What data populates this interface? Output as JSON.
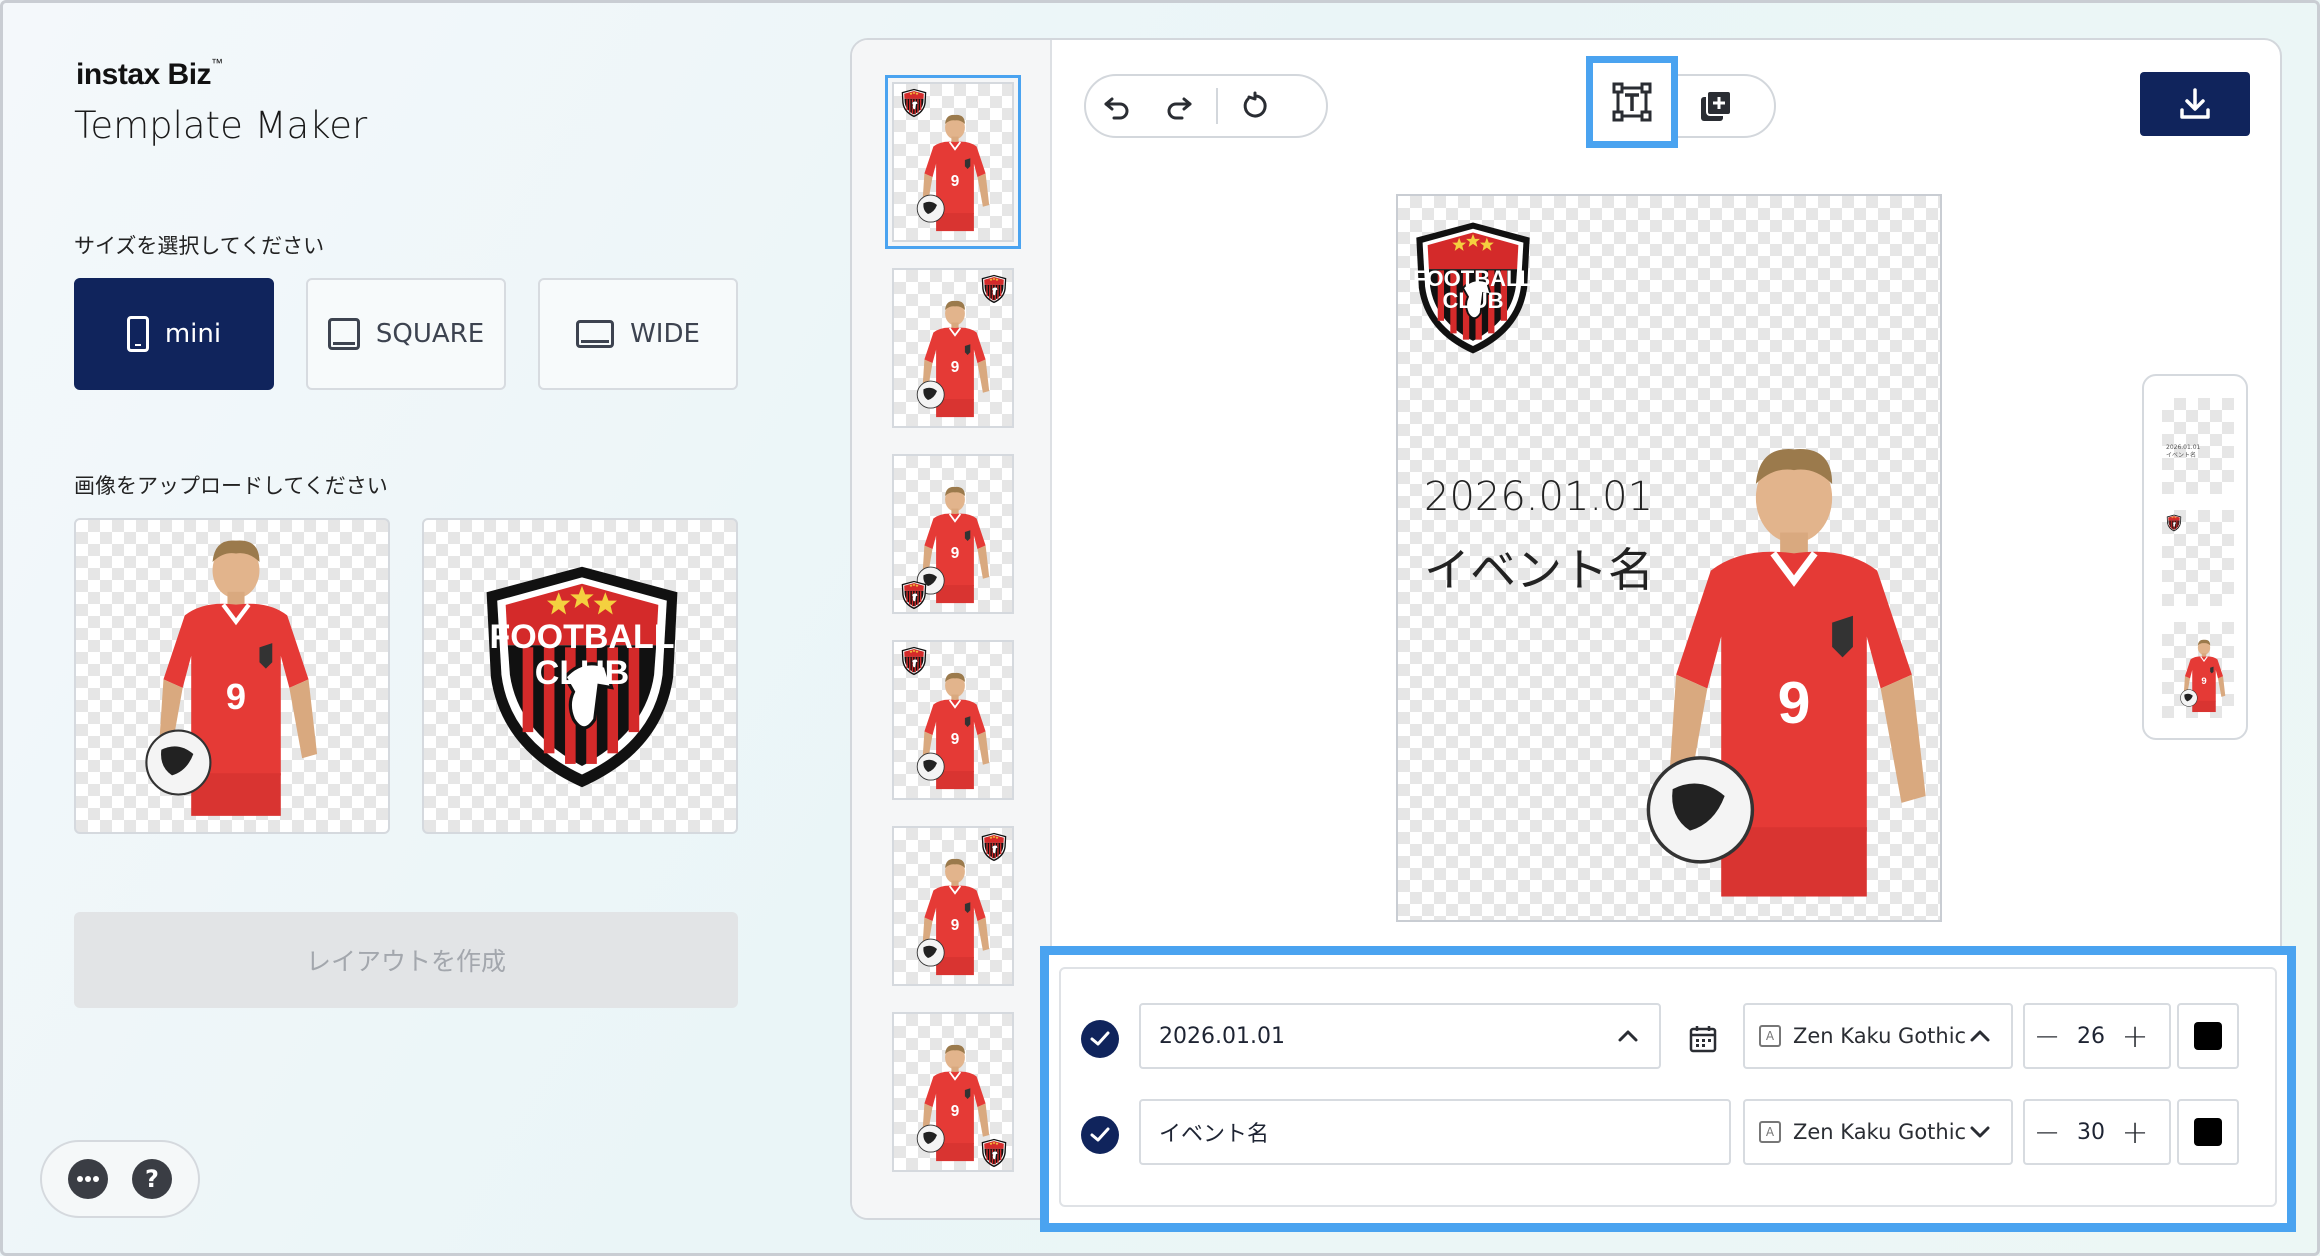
{
  "brand": {
    "name": "instax Biz",
    "tm": "™"
  },
  "app_title": "Template Maker",
  "size_section": {
    "label": "サイズを選択してください",
    "options": [
      {
        "label": "mini",
        "icon": "phone-portrait-icon",
        "selected": true
      },
      {
        "label": "SQUARE",
        "icon": "square-format-icon",
        "selected": false
      },
      {
        "label": "WIDE",
        "icon": "wide-format-icon",
        "selected": false
      }
    ]
  },
  "upload_section": {
    "label": "画像をアップロードしてください",
    "images": [
      {
        "name": "player-photo"
      },
      {
        "name": "football-club-logo",
        "logo_text": [
          "FOOTBALL",
          "CLUB"
        ]
      }
    ]
  },
  "create_button": {
    "label": "レイアウトを作成",
    "enabled": false
  },
  "help": {
    "more_icon": "more-icon",
    "help_icon": "help-icon",
    "help_glyph": "?"
  },
  "layouts": {
    "count": 6,
    "selected_index": 0
  },
  "toolbar": {
    "history": [
      "undo-icon",
      "redo-icon",
      "reset-icon"
    ],
    "tools": [
      "add-text-icon",
      "add-image-icon"
    ],
    "highlighted_tool": "add-text-icon",
    "download_icon": "download-icon"
  },
  "canvas": {
    "date_text": "2026.01.01",
    "event_text": "イベント名",
    "logo_text": [
      "FOOTBALL",
      "CLUB"
    ],
    "jersey_number": "9"
  },
  "layers_panel": {
    "tiny_text": [
      "2026.01.01",
      "イベント名"
    ]
  },
  "text_properties": [
    {
      "enabled": true,
      "value": "2026.01.01",
      "expanded": true,
      "has_calendar": true,
      "font": "Zen Kaku Gothic",
      "font_open": true,
      "size": "26",
      "color": "#000000"
    },
    {
      "enabled": true,
      "value": "イベント名",
      "expanded": false,
      "has_calendar": false,
      "font": "Zen Kaku Gothic",
      "font_open": false,
      "size": "30",
      "color": "#000000"
    }
  ],
  "colors": {
    "navy": "#10245c",
    "highlight": "#4aa3f0",
    "jersey_red": "#e53a36"
  }
}
